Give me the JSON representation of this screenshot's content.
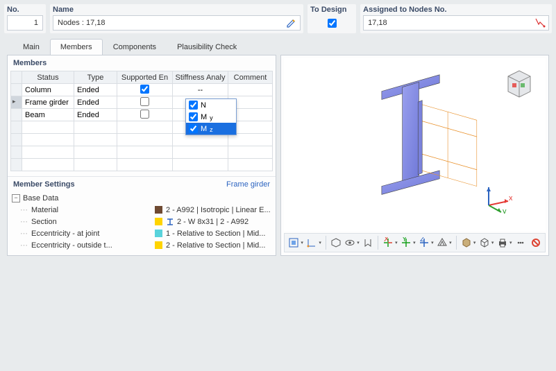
{
  "top": {
    "no_label": "No.",
    "no_value": "1",
    "name_label": "Name",
    "name_value": "Nodes : 17,18",
    "to_design_label": "To Design",
    "to_design_checked": true,
    "assigned_label": "Assigned to Nodes No.",
    "assigned_value": "17,18"
  },
  "tabs": {
    "main": "Main",
    "members": "Members",
    "components": "Components",
    "plausibility": "Plausibility Check",
    "active": "members"
  },
  "members": {
    "title": "Members",
    "columns": {
      "status": "Status",
      "type": "Type",
      "supported": "Supported Ends",
      "stiffness": "Stiffness Analysis",
      "comment": "Comment"
    },
    "rows": [
      {
        "status": "Column",
        "type": "Ended",
        "supported": true,
        "stiffness": "--",
        "comment": ""
      },
      {
        "status": "Frame girder",
        "type": "Ended",
        "supported": false,
        "stiffness": "",
        "comment": ""
      },
      {
        "status": "Beam",
        "type": "Ended",
        "supported": false,
        "stiffness": "",
        "comment": ""
      }
    ],
    "dropdown": {
      "options": [
        {
          "label": "N",
          "sub": "",
          "checked": true
        },
        {
          "label": "M",
          "sub": "y",
          "checked": true
        },
        {
          "label": "M",
          "sub": "z",
          "checked": true
        }
      ],
      "selected_index": 2
    }
  },
  "settings": {
    "title": "Member Settings",
    "subtitle": "Frame girder",
    "base_data": "Base Data",
    "rows": [
      {
        "label": "Material",
        "swatch": "#6f4a32",
        "value": "2 - A992 | Isotropic | Linear E..."
      },
      {
        "label": "Section",
        "swatch": "#ffd400",
        "icon": "i-beam",
        "value": "2 - W 8x31 | 2 - A992"
      },
      {
        "label": "Eccentricity - at joint",
        "swatch": "#59d3dc",
        "value": "1 - Relative to Section | Mid..."
      },
      {
        "label": "Eccentricity - outside t...",
        "swatch": "#ffd400",
        "value": "2 - Relative to Section | Mid..."
      }
    ]
  },
  "viewer_toolbar": {
    "buttons": [
      "select-tool",
      "coord-tool",
      "iso-view",
      "eye-view",
      "walkthrough",
      "view-xy",
      "view-yz",
      "view-xz",
      "perspective",
      "solid",
      "wireframe",
      "print",
      "extras",
      "reset"
    ]
  }
}
